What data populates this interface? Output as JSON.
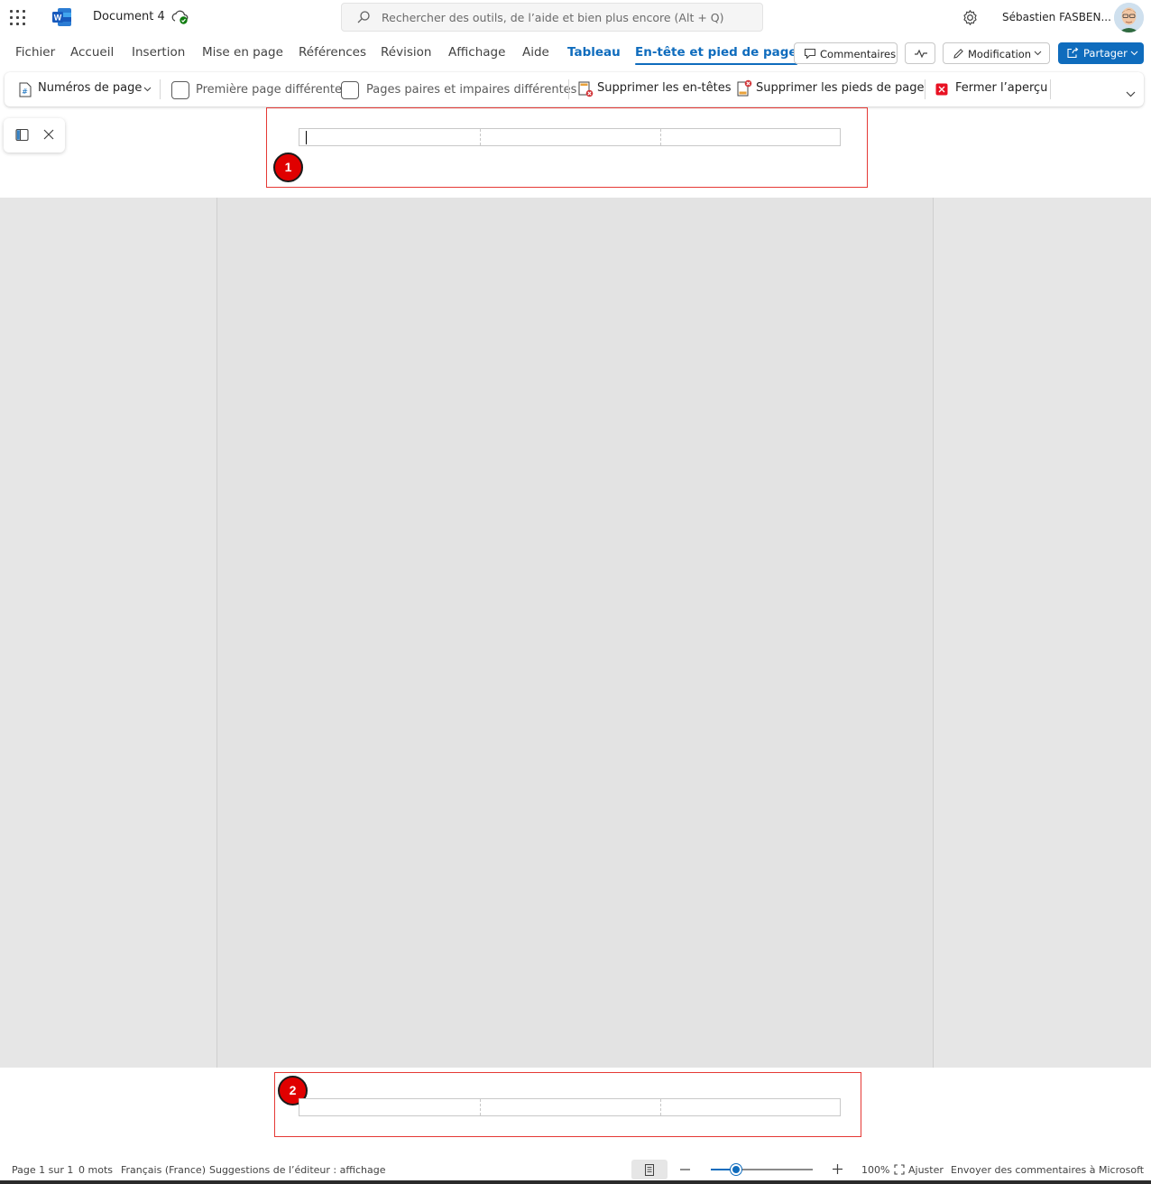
{
  "titlebar": {
    "doc_title": "Document 4",
    "search_placeholder": "Rechercher des outils, de l’aide et bien plus encore (Alt + Q)",
    "user_name": "Sébastien FASBEN..."
  },
  "tabs": [
    {
      "label": "Fichier"
    },
    {
      "label": "Accueil"
    },
    {
      "label": "Insertion"
    },
    {
      "label": "Mise en page"
    },
    {
      "label": "Références"
    },
    {
      "label": "Révision"
    },
    {
      "label": "Affichage"
    },
    {
      "label": "Aide"
    },
    {
      "label": "Tableau"
    },
    {
      "label": "En-tête et pied de page"
    }
  ],
  "actions": {
    "comments": "Commentaires",
    "editing": "Modification",
    "share": "Partager"
  },
  "ribbon": {
    "page_numbers": "Numéros de page",
    "first_page_different": "Première page différente",
    "odd_even_different": "Pages paires et impaires différentes",
    "remove_headers": "Supprimer les en-têtes",
    "remove_footers": "Supprimer les pieds de page",
    "close_preview": "Fermer l’aperçu"
  },
  "annotations": {
    "header_badge": "1",
    "footer_badge": "2"
  },
  "status": {
    "page": "Page 1 sur 1",
    "words": "0 mots",
    "language": "Français (France)",
    "editor": "Suggestions de l’éditeur : affichage",
    "zoom": "100%",
    "fit": "Ajuster",
    "feedback": "Envoyer des commentaires à Microsoft",
    "zoom_level": 0.22
  },
  "colors": {
    "accent": "#0f6cbd",
    "annotation_red": "#e53935",
    "badge_red": "#e00000"
  }
}
